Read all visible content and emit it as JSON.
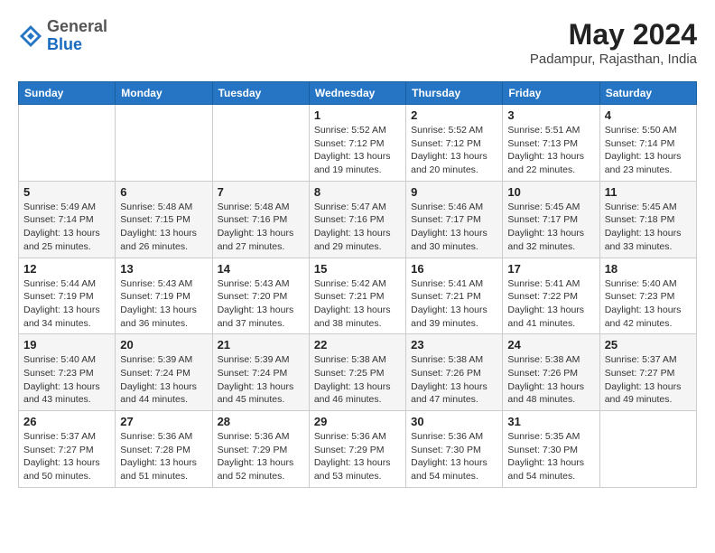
{
  "header": {
    "logo_general": "General",
    "logo_blue": "Blue",
    "month_year": "May 2024",
    "location": "Padampur, Rajasthan, India"
  },
  "days_of_week": [
    "Sunday",
    "Monday",
    "Tuesday",
    "Wednesday",
    "Thursday",
    "Friday",
    "Saturday"
  ],
  "weeks": [
    [
      {
        "day": "",
        "info": ""
      },
      {
        "day": "",
        "info": ""
      },
      {
        "day": "",
        "info": ""
      },
      {
        "day": "1",
        "info": "Sunrise: 5:52 AM\nSunset: 7:12 PM\nDaylight: 13 hours\nand 19 minutes."
      },
      {
        "day": "2",
        "info": "Sunrise: 5:52 AM\nSunset: 7:12 PM\nDaylight: 13 hours\nand 20 minutes."
      },
      {
        "day": "3",
        "info": "Sunrise: 5:51 AM\nSunset: 7:13 PM\nDaylight: 13 hours\nand 22 minutes."
      },
      {
        "day": "4",
        "info": "Sunrise: 5:50 AM\nSunset: 7:14 PM\nDaylight: 13 hours\nand 23 minutes."
      }
    ],
    [
      {
        "day": "5",
        "info": "Sunrise: 5:49 AM\nSunset: 7:14 PM\nDaylight: 13 hours\nand 25 minutes."
      },
      {
        "day": "6",
        "info": "Sunrise: 5:48 AM\nSunset: 7:15 PM\nDaylight: 13 hours\nand 26 minutes."
      },
      {
        "day": "7",
        "info": "Sunrise: 5:48 AM\nSunset: 7:16 PM\nDaylight: 13 hours\nand 27 minutes."
      },
      {
        "day": "8",
        "info": "Sunrise: 5:47 AM\nSunset: 7:16 PM\nDaylight: 13 hours\nand 29 minutes."
      },
      {
        "day": "9",
        "info": "Sunrise: 5:46 AM\nSunset: 7:17 PM\nDaylight: 13 hours\nand 30 minutes."
      },
      {
        "day": "10",
        "info": "Sunrise: 5:45 AM\nSunset: 7:17 PM\nDaylight: 13 hours\nand 32 minutes."
      },
      {
        "day": "11",
        "info": "Sunrise: 5:45 AM\nSunset: 7:18 PM\nDaylight: 13 hours\nand 33 minutes."
      }
    ],
    [
      {
        "day": "12",
        "info": "Sunrise: 5:44 AM\nSunset: 7:19 PM\nDaylight: 13 hours\nand 34 minutes."
      },
      {
        "day": "13",
        "info": "Sunrise: 5:43 AM\nSunset: 7:19 PM\nDaylight: 13 hours\nand 36 minutes."
      },
      {
        "day": "14",
        "info": "Sunrise: 5:43 AM\nSunset: 7:20 PM\nDaylight: 13 hours\nand 37 minutes."
      },
      {
        "day": "15",
        "info": "Sunrise: 5:42 AM\nSunset: 7:21 PM\nDaylight: 13 hours\nand 38 minutes."
      },
      {
        "day": "16",
        "info": "Sunrise: 5:41 AM\nSunset: 7:21 PM\nDaylight: 13 hours\nand 39 minutes."
      },
      {
        "day": "17",
        "info": "Sunrise: 5:41 AM\nSunset: 7:22 PM\nDaylight: 13 hours\nand 41 minutes."
      },
      {
        "day": "18",
        "info": "Sunrise: 5:40 AM\nSunset: 7:23 PM\nDaylight: 13 hours\nand 42 minutes."
      }
    ],
    [
      {
        "day": "19",
        "info": "Sunrise: 5:40 AM\nSunset: 7:23 PM\nDaylight: 13 hours\nand 43 minutes."
      },
      {
        "day": "20",
        "info": "Sunrise: 5:39 AM\nSunset: 7:24 PM\nDaylight: 13 hours\nand 44 minutes."
      },
      {
        "day": "21",
        "info": "Sunrise: 5:39 AM\nSunset: 7:24 PM\nDaylight: 13 hours\nand 45 minutes."
      },
      {
        "day": "22",
        "info": "Sunrise: 5:38 AM\nSunset: 7:25 PM\nDaylight: 13 hours\nand 46 minutes."
      },
      {
        "day": "23",
        "info": "Sunrise: 5:38 AM\nSunset: 7:26 PM\nDaylight: 13 hours\nand 47 minutes."
      },
      {
        "day": "24",
        "info": "Sunrise: 5:38 AM\nSunset: 7:26 PM\nDaylight: 13 hours\nand 48 minutes."
      },
      {
        "day": "25",
        "info": "Sunrise: 5:37 AM\nSunset: 7:27 PM\nDaylight: 13 hours\nand 49 minutes."
      }
    ],
    [
      {
        "day": "26",
        "info": "Sunrise: 5:37 AM\nSunset: 7:27 PM\nDaylight: 13 hours\nand 50 minutes."
      },
      {
        "day": "27",
        "info": "Sunrise: 5:36 AM\nSunset: 7:28 PM\nDaylight: 13 hours\nand 51 minutes."
      },
      {
        "day": "28",
        "info": "Sunrise: 5:36 AM\nSunset: 7:29 PM\nDaylight: 13 hours\nand 52 minutes."
      },
      {
        "day": "29",
        "info": "Sunrise: 5:36 AM\nSunset: 7:29 PM\nDaylight: 13 hours\nand 53 minutes."
      },
      {
        "day": "30",
        "info": "Sunrise: 5:36 AM\nSunset: 7:30 PM\nDaylight: 13 hours\nand 54 minutes."
      },
      {
        "day": "31",
        "info": "Sunrise: 5:35 AM\nSunset: 7:30 PM\nDaylight: 13 hours\nand 54 minutes."
      },
      {
        "day": "",
        "info": ""
      }
    ]
  ]
}
